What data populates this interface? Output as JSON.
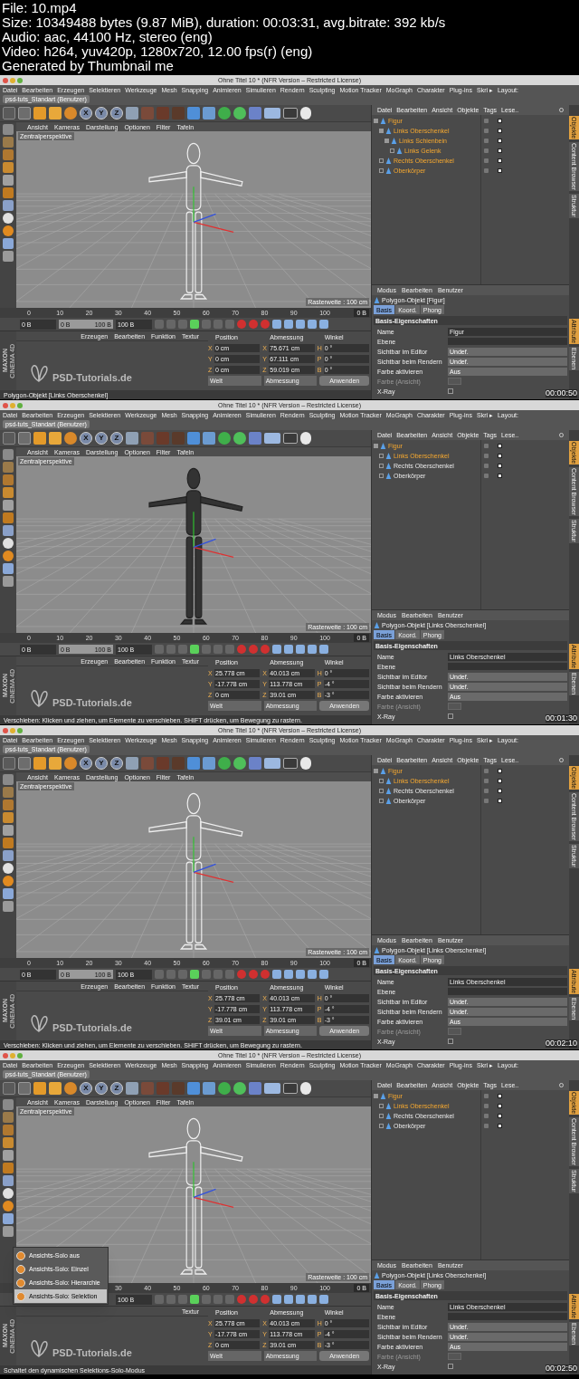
{
  "header": [
    "File: 10.mp4",
    "Size: 10349488 bytes (9.87 MiB), duration: 00:03:31, avg.bitrate: 392 kb/s",
    "Audio: aac, 44100 Hz, stereo (eng)",
    "Video: h264, yuv420p, 1280x720, 12.00 fps(r) (eng)",
    "Generated by Thumbnail me"
  ],
  "frames": [
    {
      "timestamp": "00:00:50",
      "window_title": "Ohne Titel 10 * (NFR Version – Restricted License)",
      "menu": [
        "Datei",
        "Bearbeiten",
        "Erzeugen",
        "Selektieren",
        "Werkzeuge",
        "Mesh",
        "Snapping",
        "Animieren",
        "Simulieren",
        "Rendern",
        "Sculpting",
        "Motion Tracker",
        "MoGraph",
        "Charakter",
        "Plug-ins",
        "Skri ▸",
        "Layout:"
      ],
      "layout": "psd-tuts_Standart (Benutzer)",
      "axis_buttons": [
        "X",
        "Y",
        "Z"
      ],
      "viewport": {
        "menu": [
          "Ansicht",
          "Kameras",
          "Darstellung",
          "Optionen",
          "Filter",
          "Tafeln"
        ],
        "camera": "Zentralperspektive",
        "grid": "Rasterweite : 100 cm",
        "figure": {
          "kind": "wireframe"
        }
      },
      "ruler": [
        "0",
        "10",
        "20",
        "30",
        "40",
        "50",
        "60",
        "70",
        "80",
        "90",
        "100"
      ],
      "ruler_end": "0 B",
      "time": {
        "start": "0 B",
        "range": {
          "from": "0 B",
          "to": "100 B",
          "level": 1
        },
        "end": "100 B"
      },
      "material": {
        "menu": [
          "Erzeugen",
          "Bearbeiten",
          "Funktion",
          "Textur"
        ],
        "logo": "PSD-Tutorials.de"
      },
      "maxon": [
        "MAXON",
        "CINEMA 4D"
      ],
      "coords": {
        "headers": [
          "Position",
          "Abmessung",
          "Winkel"
        ],
        "rows": [
          {
            "a": "X",
            "p": "0 cm",
            "b": "X",
            "s": "75.671 cm",
            "c": "H",
            "w": "0 °"
          },
          {
            "a": "Y",
            "p": "0 cm",
            "b": "Y",
            "s": "67.111 cm",
            "c": "P",
            "w": "0 °"
          },
          {
            "a": "Z",
            "p": "0 cm",
            "b": "Z",
            "s": "59.019 cm",
            "c": "B",
            "w": "0 °"
          }
        ],
        "mode": "Welt",
        "size_mode": "Abmessung",
        "apply": "Anwenden"
      },
      "status": "Polygon-Objekt [Links Oberschenkel]",
      "objects": {
        "menu": [
          "Datei",
          "Bearbeiten",
          "Ansicht",
          "Objekte",
          "Tags",
          "Lese.."
        ],
        "tree": [
          {
            "name": "Figur",
            "selected": true,
            "expanded": true,
            "children": [
              {
                "name": "Links Oberschenkel",
                "selected": true,
                "expanded": true,
                "children": [
                  {
                    "name": "Links Schienbein",
                    "selected": true,
                    "expanded": true,
                    "children": [
                      {
                        "name": "Links Gelenk",
                        "selected": true,
                        "expanded": false
                      }
                    ]
                  }
                ]
              },
              {
                "name": "Rechts Oberschenkel",
                "selected": true,
                "expanded": false
              },
              {
                "name": "Oberkörper",
                "selected": true,
                "expanded": false
              }
            ]
          }
        ]
      },
      "side_tabs_top": [
        {
          "label": "Objekte",
          "selected": true
        },
        {
          "label": "Content Browser",
          "selected": false
        },
        {
          "label": "Struktur",
          "selected": false
        }
      ],
      "attributes": {
        "menu": [
          "Modus",
          "Bearbeiten",
          "Benutzer"
        ],
        "object": "Polygon-Objekt [Figur]",
        "tabs": [
          {
            "label": "Basis",
            "selected": true
          },
          {
            "label": "Koord.",
            "selected": false
          },
          {
            "label": "Phong",
            "selected": false
          }
        ],
        "section": "Basis-Eigenschaften",
        "fields": [
          {
            "kind": "text",
            "label": "Name",
            "value": "Figur"
          },
          {
            "kind": "layer",
            "label": "Ebene"
          },
          {
            "kind": "select",
            "label": "Sichtbar im Editor",
            "value": "Undef."
          },
          {
            "kind": "select",
            "label": "Sichtbar beim Rendern",
            "value": "Undef."
          },
          {
            "kind": "select",
            "label": "Farbe aktivieren",
            "value": "Aus"
          },
          {
            "kind": "color",
            "label": "Farbe (Ansicht)",
            "disabled": true
          },
          {
            "kind": "checkbox",
            "label": "X-Ray",
            "checked": false
          }
        ]
      },
      "side_tabs_bottom": [
        {
          "label": "Attribute",
          "selected": true
        },
        {
          "label": "Ebenen",
          "selected": false
        }
      ]
    },
    {
      "timestamp": "00:01:30",
      "window_title": "Ohne Titel 10 * (NFR Version – Restricted License)",
      "menu": [
        "Datei",
        "Bearbeiten",
        "Erzeugen",
        "Selektieren",
        "Werkzeuge",
        "Mesh",
        "Snapping",
        "Animieren",
        "Simulieren",
        "Rendern",
        "Sculpting",
        "Motion Tracker",
        "MoGraph",
        "Charakter",
        "Plug-ins",
        "Skri ▸",
        "Layout:"
      ],
      "layout": "psd-tuts_Standart (Benutzer)",
      "axis_buttons": [
        "X",
        "Y",
        "Z"
      ],
      "viewport": {
        "menu": [
          "Ansicht",
          "Kameras",
          "Darstellung",
          "Optionen",
          "Filter",
          "Tafeln"
        ],
        "camera": "Zentralperspektive",
        "grid": "Rasterweite : 100 cm",
        "figure": {
          "kind": "solid"
        }
      },
      "ruler": [
        "0",
        "10",
        "20",
        "30",
        "40",
        "50",
        "60",
        "70",
        "80",
        "90",
        "100"
      ],
      "ruler_end": "0 B",
      "time": {
        "start": "0 B",
        "range": {
          "from": "0 B",
          "to": "100 B",
          "level": 1
        },
        "end": "100 B"
      },
      "material": {
        "menu": [
          "Erzeugen",
          "Bearbeiten",
          "Funktion",
          "Textur"
        ],
        "logo": "PSD-Tutorials.de"
      },
      "maxon": [
        "MAXON",
        "CINEMA 4D"
      ],
      "coords": {
        "headers": [
          "Position",
          "Abmessung",
          "Winkel"
        ],
        "rows": [
          {
            "a": "X",
            "p": "25.778 cm",
            "b": "X",
            "s": "40.013 cm",
            "c": "H",
            "w": "0 °"
          },
          {
            "a": "Y",
            "p": "-17.778 cm",
            "b": "Y",
            "s": "113.778 cm",
            "c": "P",
            "w": "-4 °"
          },
          {
            "a": "Z",
            "p": "0 cm",
            "b": "Z",
            "s": "39.01 cm",
            "c": "B",
            "w": "-3 °"
          }
        ],
        "mode": "Welt",
        "size_mode": "Abmessung",
        "apply": "Anwenden"
      },
      "status": "Verschieben: Klicken und ziehen, um Elemente zu verschieben. SHIFT drücken, um Bewegung zu rastern.",
      "objects": {
        "menu": [
          "Datei",
          "Bearbeiten",
          "Ansicht",
          "Objekte",
          "Tags",
          "Lese.."
        ],
        "tree": [
          {
            "name": "Figur",
            "selected": true,
            "expanded": true,
            "children": [
              {
                "name": "Links Oberschenkel",
                "selected": true,
                "expanded": false
              },
              {
                "name": "Rechts Oberschenkel",
                "selected": false,
                "expanded": false
              },
              {
                "name": "Oberkörper",
                "selected": false,
                "expanded": false
              }
            ]
          }
        ]
      },
      "side_tabs_top": [
        {
          "label": "Objekte",
          "selected": true
        },
        {
          "label": "Content Browser",
          "selected": false
        },
        {
          "label": "Struktur",
          "selected": false
        }
      ],
      "attributes": {
        "menu": [
          "Modus",
          "Bearbeiten",
          "Benutzer"
        ],
        "object": "Polygon-Objekt [Links Oberschenkel]",
        "tabs": [
          {
            "label": "Basis",
            "selected": true
          },
          {
            "label": "Koord.",
            "selected": false
          },
          {
            "label": "Phong",
            "selected": false
          }
        ],
        "section": "Basis-Eigenschaften",
        "fields": [
          {
            "kind": "text",
            "label": "Name",
            "value": "Links Oberschenkel"
          },
          {
            "kind": "layer",
            "label": "Ebene"
          },
          {
            "kind": "select",
            "label": "Sichtbar im Editor",
            "value": "Undef."
          },
          {
            "kind": "select",
            "label": "Sichtbar beim Rendern",
            "value": "Undef."
          },
          {
            "kind": "select",
            "label": "Farbe aktivieren",
            "value": "Aus"
          },
          {
            "kind": "color",
            "label": "Farbe (Ansicht)",
            "disabled": true
          },
          {
            "kind": "checkbox",
            "label": "X-Ray",
            "checked": false
          }
        ]
      },
      "side_tabs_bottom": [
        {
          "label": "Attribute",
          "selected": true
        },
        {
          "label": "Ebenen",
          "selected": false
        }
      ]
    },
    {
      "timestamp": "00:02:10",
      "window_title": "Ohne Titel 10 * (NFR Version – Restricted License)",
      "menu": [
        "Datei",
        "Bearbeiten",
        "Erzeugen",
        "Selektieren",
        "Werkzeuge",
        "Mesh",
        "Snapping",
        "Animieren",
        "Simulieren",
        "Rendern",
        "Sculpting",
        "Motion Tracker",
        "MoGraph",
        "Charakter",
        "Plug-ins",
        "Skri ▸",
        "Layout:"
      ],
      "layout": "psd-tuts_Standart (Benutzer)",
      "axis_buttons": [
        "X",
        "Y",
        "Z"
      ],
      "viewport": {
        "menu": [
          "Ansicht",
          "Kameras",
          "Darstellung",
          "Optionen",
          "Filter",
          "Tafeln"
        ],
        "camera": "Zentralperspektive",
        "grid": "Rasterweite : 100 cm",
        "figure": {
          "kind": "wireframe"
        }
      },
      "ruler": [
        "0",
        "10",
        "20",
        "30",
        "40",
        "50",
        "60",
        "70",
        "80",
        "90",
        "100"
      ],
      "ruler_end": "0 B",
      "time": {
        "start": "0 B",
        "range": {
          "from": "0 B",
          "to": "100 B",
          "level": 1
        },
        "end": "100 B"
      },
      "material": {
        "menu": [
          "Erzeugen",
          "Bearbeiten",
          "Funktion",
          "Textur"
        ],
        "logo": "PSD-Tutorials.de"
      },
      "maxon": [
        "MAXON",
        "CINEMA 4D"
      ],
      "coords": {
        "headers": [
          "Position",
          "Abmessung",
          "Winkel"
        ],
        "rows": [
          {
            "a": "X",
            "p": "25.778 cm",
            "b": "X",
            "s": "40.013 cm",
            "c": "H",
            "w": "0 °"
          },
          {
            "a": "Y",
            "p": "-17.778 cm",
            "b": "Y",
            "s": "113.778 cm",
            "c": "P",
            "w": "-4 °"
          },
          {
            "a": "Z",
            "p": "39.01 cm",
            "b": "Z",
            "s": "39.01 cm",
            "c": "B",
            "w": "-3 °"
          }
        ],
        "mode": "Welt",
        "size_mode": "Abmessung",
        "apply": "Anwenden"
      },
      "status": "Verschieben: Klicken und ziehen, um Elemente zu verschieben. SHIFT drücken, um Bewegung zu rastern.",
      "objects": {
        "menu": [
          "Datei",
          "Bearbeiten",
          "Ansicht",
          "Objekte",
          "Tags",
          "Lese.."
        ],
        "tree": [
          {
            "name": "Figur",
            "selected": true,
            "expanded": true,
            "children": [
              {
                "name": "Links Oberschenkel",
                "selected": true,
                "expanded": false
              },
              {
                "name": "Rechts Oberschenkel",
                "selected": false,
                "expanded": false
              },
              {
                "name": "Oberkörper",
                "selected": false,
                "expanded": false
              }
            ]
          }
        ]
      },
      "side_tabs_top": [
        {
          "label": "Objekte",
          "selected": true
        },
        {
          "label": "Content Browser",
          "selected": false
        },
        {
          "label": "Struktur",
          "selected": false
        }
      ],
      "attributes": {
        "menu": [
          "Modus",
          "Bearbeiten",
          "Benutzer"
        ],
        "object": "Polygon-Objekt [Links Oberschenkel]",
        "tabs": [
          {
            "label": "Basis",
            "selected": true
          },
          {
            "label": "Koord.",
            "selected": false
          },
          {
            "label": "Phong",
            "selected": false
          }
        ],
        "section": "Basis-Eigenschaften",
        "fields": [
          {
            "kind": "text",
            "label": "Name",
            "value": "Links Oberschenkel"
          },
          {
            "kind": "layer",
            "label": "Ebene"
          },
          {
            "kind": "select",
            "label": "Sichtbar im Editor",
            "value": "Undef."
          },
          {
            "kind": "select",
            "label": "Sichtbar beim Rendern",
            "value": "Undef."
          },
          {
            "kind": "select",
            "label": "Farbe aktivieren",
            "value": "Aus"
          },
          {
            "kind": "color",
            "label": "Farbe (Ansicht)",
            "disabled": true
          },
          {
            "kind": "checkbox",
            "label": "X-Ray",
            "checked": false
          }
        ]
      },
      "side_tabs_bottom": [
        {
          "label": "Attribute",
          "selected": true
        },
        {
          "label": "Ebenen",
          "selected": false
        }
      ]
    },
    {
      "timestamp": "00:02:50",
      "window_title": "Ohne Titel 10 * (NFR Version – Restricted License)",
      "menu": [
        "Datei",
        "Bearbeiten",
        "Erzeugen",
        "Selektieren",
        "Werkzeuge",
        "Mesh",
        "Snapping",
        "Animieren",
        "Simulieren",
        "Rendern",
        "Sculpting",
        "Motion Tracker",
        "MoGraph",
        "Charakter",
        "Plug-ins",
        "Skri ▸",
        "Layout:"
      ],
      "layout": "psd-tuts_Standart (Benutzer)",
      "axis_buttons": [
        "X",
        "Y",
        "Z"
      ],
      "viewport": {
        "menu": [
          "Ansicht",
          "Kameras",
          "Darstellung",
          "Optionen",
          "Filter",
          "Tafeln"
        ],
        "camera": "Zentralperspektive",
        "grid": "Rasterweite : 100 cm",
        "figure": {
          "kind": "wireframe"
        }
      },
      "ruler": [
        "30",
        "40",
        "50",
        "60",
        "70",
        "80",
        "90",
        "100"
      ],
      "ruler_end": "0 B",
      "time": {
        "end": "100 B"
      },
      "material": {
        "menu": [
          "Textur"
        ],
        "logo": "PSD-Tutorials.de"
      },
      "maxon": [
        "MAXON",
        "CINEMA 4D"
      ],
      "coords": {
        "headers": [
          "Position",
          "Abmessung",
          "Winkel"
        ],
        "rows": [
          {
            "a": "X",
            "p": "25.778 cm",
            "b": "X",
            "s": "40.013 cm",
            "c": "H",
            "w": "0 °"
          },
          {
            "a": "Y",
            "p": "-17.778 cm",
            "b": "Y",
            "s": "113.778 cm",
            "c": "P",
            "w": "-4 °"
          },
          {
            "a": "Z",
            "p": "0 cm",
            "b": "Z",
            "s": "39.01 cm",
            "c": "B",
            "w": "-3 °"
          }
        ],
        "mode": "Welt",
        "size_mode": "Abmessung",
        "apply": "Anwenden"
      },
      "status": "Schaltet den dynamischen Selektions-Solo-Modus",
      "popup": [
        {
          "label": "Ansichts-Solo aus",
          "selected": false
        },
        {
          "label": "Ansichts-Solo: Einzel",
          "selected": false
        },
        {
          "label": "Ansichts-Solo: Hierarchie",
          "selected": false
        },
        {
          "label": "Ansichts-Solo: Selektion",
          "selected": true
        }
      ],
      "objects": {
        "menu": [
          "Datei",
          "Bearbeiten",
          "Ansicht",
          "Objekte",
          "Tags",
          "Lese.."
        ],
        "tree": [
          {
            "name": "Figur",
            "selected": true,
            "expanded": true,
            "children": [
              {
                "name": "Links Oberschenkel",
                "selected": true,
                "expanded": false
              },
              {
                "name": "Rechts Oberschenkel",
                "selected": false,
                "expanded": false
              },
              {
                "name": "Oberkörper",
                "selected": false,
                "expanded": false
              }
            ]
          }
        ]
      },
      "side_tabs_top": [
        {
          "label": "Objekte",
          "selected": true
        },
        {
          "label": "Content Browser",
          "selected": false
        },
        {
          "label": "Struktur",
          "selected": false
        }
      ],
      "attributes": {
        "menu": [
          "Modus",
          "Bearbeiten",
          "Benutzer"
        ],
        "object": "Polygon-Objekt [Links Oberschenkel]",
        "tabs": [
          {
            "label": "Basis",
            "selected": true
          },
          {
            "label": "Koord.",
            "selected": false
          },
          {
            "label": "Phong",
            "selected": false
          }
        ],
        "section": "Basis-Eigenschaften",
        "fields": [
          {
            "kind": "text",
            "label": "Name",
            "value": "Links Oberschenkel"
          },
          {
            "kind": "layer",
            "label": "Ebene"
          },
          {
            "kind": "select",
            "label": "Sichtbar im Editor",
            "value": "Undef."
          },
          {
            "kind": "select",
            "label": "Sichtbar beim Rendern",
            "value": "Undef."
          },
          {
            "kind": "select",
            "label": "Farbe aktivieren",
            "value": "Aus"
          },
          {
            "kind": "color",
            "label": "Farbe (Ansicht)",
            "disabled": true
          },
          {
            "kind": "checkbox",
            "label": "X-Ray",
            "checked": false
          }
        ]
      },
      "side_tabs_bottom": [
        {
          "label": "Attribute",
          "selected": true
        },
        {
          "label": "Ebenen",
          "selected": false
        }
      ]
    }
  ]
}
